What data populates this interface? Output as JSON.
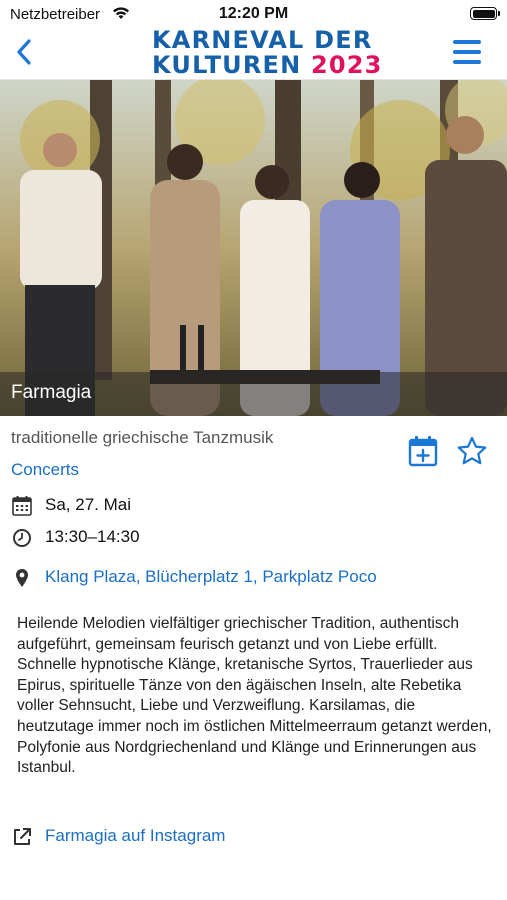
{
  "status_bar": {
    "carrier": "Netzbetreiber",
    "time": "12:20 PM",
    "wifi_icon": "wifi-icon",
    "battery_icon": "battery-icon"
  },
  "header": {
    "back_icon": "chevron-left-icon",
    "logo_line1": "KARNEVAL DER",
    "logo_line2_text": "KULTUREN",
    "logo_line2_year": "2023",
    "menu_icon": "hamburger-menu-icon",
    "colors": {
      "logo_blue": "#1560a8",
      "logo_pink": "#e0115f",
      "accent": "#1a78d4"
    }
  },
  "hero": {
    "title": "Farmagia"
  },
  "event": {
    "subtitle": "traditionelle griechische Tanzmusik",
    "category": "Concerts",
    "add_to_calendar_icon": "calendar-add-icon",
    "favorite_icon": "star-outline-icon",
    "date": "Sa, 27. Mai",
    "time": "13:30–14:30",
    "location": "Klang Plaza, Blücherplatz 1, Parkplatz Poco",
    "description": "Heilende Melodien vielfältiger griechischer Tradition, authentisch aufgeführt, gemeinsam feurisch getanzt und von Liebe erfüllt. Schnelle hypnotische Klänge, kretanische Syrtos, Trauerlieder aus Epirus, spirituelle Tänze von den ägäischen Inseln, alte Rebetika voller Sehnsucht, Liebe und Verzweiflung. Karsilamas, die heutzutage immer noch im östlichen Mittelmeerraum getanzt werden, Polyfonie aus Nordgriechenland und Klänge und Erinnerungen aus Istanbul.",
    "instagram_link": "Farmagia auf Instagram",
    "link_color": "#1a6fc4"
  }
}
